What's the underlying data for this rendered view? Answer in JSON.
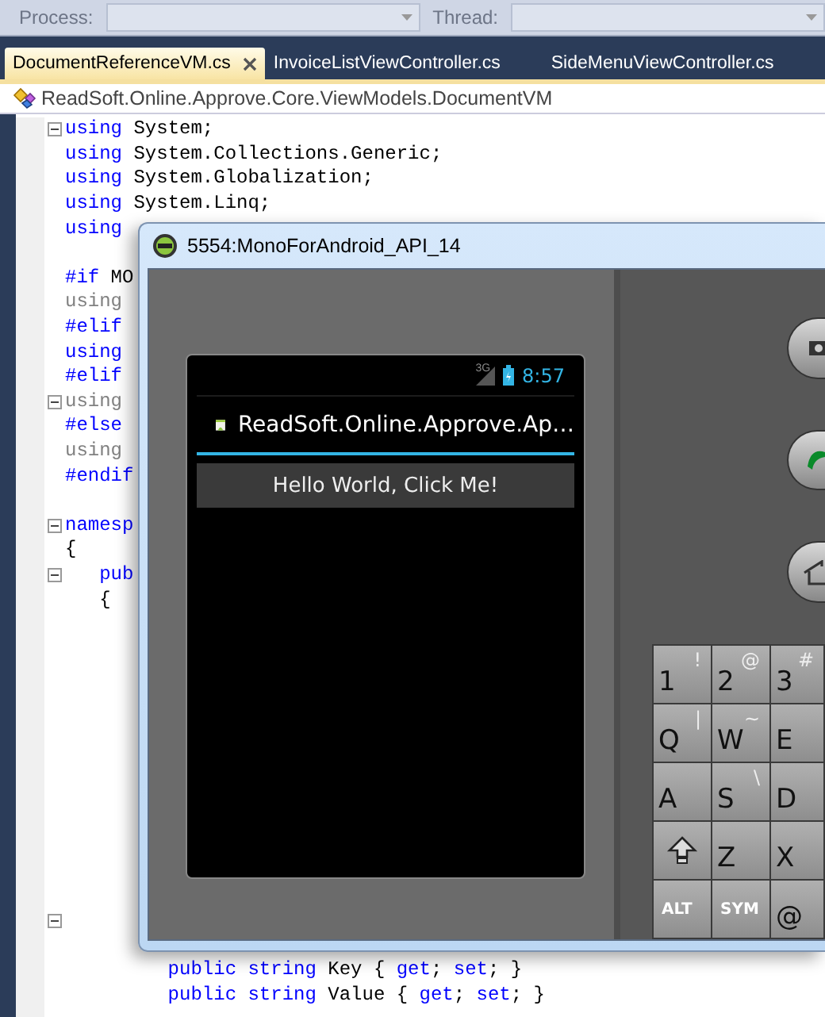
{
  "toolbar": {
    "fields": [
      {
        "label": "Process:"
      },
      {
        "label": "Thread:"
      }
    ]
  },
  "tabs": [
    {
      "label": "DocumentReferenceVM.cs",
      "selected": true,
      "closable": true
    },
    {
      "label": "InvoiceListViewController.cs",
      "selected": false,
      "closable": false
    },
    {
      "label": "SideMenuViewController.cs",
      "selected": false,
      "closable": false
    }
  ],
  "navigation_bar": {
    "type": "ReadSoft.Online.Approve.Core.ViewModels.DocumentVM"
  },
  "code_lines": [
    {
      "fold": true,
      "tokens": [
        {
          "text": "using",
          "kind": "keyword"
        },
        {
          "text": " System;",
          "kind": "plain"
        }
      ]
    },
    {
      "fold": false,
      "tokens": [
        {
          "text": "using",
          "kind": "keyword"
        },
        {
          "text": " System.Collections.Generic;",
          "kind": "plain"
        }
      ]
    },
    {
      "fold": false,
      "tokens": [
        {
          "text": "using",
          "kind": "keyword"
        },
        {
          "text": " System.Globalization;",
          "kind": "plain"
        }
      ]
    },
    {
      "fold": false,
      "tokens": [
        {
          "text": "using",
          "kind": "keyword"
        },
        {
          "text": " System.Linq;",
          "kind": "plain"
        }
      ]
    },
    {
      "fold": false,
      "tokens": [
        {
          "text": "using",
          "kind": "keyword"
        }
      ]
    },
    {
      "fold": false
    },
    {
      "fold": false,
      "tokens": [
        {
          "text": "#if",
          "kind": "keyword"
        },
        {
          "text": " MO",
          "kind": "plain"
        }
      ]
    },
    {
      "fold": false,
      "tokens": [
        {
          "text": "using",
          "kind": "inactive"
        }
      ]
    },
    {
      "fold": false,
      "tokens": [
        {
          "text": "#elif",
          "kind": "keyword"
        }
      ]
    },
    {
      "fold": false,
      "tokens": [
        {
          "text": "using",
          "kind": "keyword"
        }
      ]
    },
    {
      "fold": false,
      "tokens": [
        {
          "text": "#elif",
          "kind": "keyword"
        }
      ]
    },
    {
      "fold": true,
      "tokens": [
        {
          "text": "using",
          "kind": "inactive"
        }
      ]
    },
    {
      "fold": false,
      "tokens": [
        {
          "text": "#else",
          "kind": "keyword"
        }
      ]
    },
    {
      "fold": false,
      "tokens": [
        {
          "text": "using",
          "kind": "inactive"
        }
      ]
    },
    {
      "fold": false,
      "tokens": [
        {
          "text": "#endif",
          "kind": "keyword"
        }
      ]
    },
    {
      "fold": false
    },
    {
      "fold": true,
      "tokens": [
        {
          "text": "namesp",
          "kind": "keyword"
        }
      ]
    },
    {
      "fold": false,
      "tokens": [
        {
          "text": "{",
          "kind": "plain"
        }
      ]
    },
    {
      "fold": true,
      "tokens": [
        {
          "text": "   pub",
          "kind": "keyword"
        }
      ]
    },
    {
      "fold": false,
      "tokens": [
        {
          "text": "   {",
          "kind": "plain"
        }
      ]
    },
    {
      "fold": false
    },
    {
      "fold": false
    },
    {
      "fold": false
    },
    {
      "fold": false
    },
    {
      "fold": false
    },
    {
      "fold": false
    },
    {
      "fold": false
    },
    {
      "fold": false
    },
    {
      "fold": false
    },
    {
      "fold": false
    },
    {
      "fold": false
    },
    {
      "fold": false
    },
    {
      "fold": true
    },
    {
      "fold": false
    },
    {
      "fold": false,
      "tokens": [
        {
          "text": "         public string",
          "kind": "keyword"
        },
        {
          "text": " Key { ",
          "kind": "plain"
        },
        {
          "text": "get",
          "kind": "keyword"
        },
        {
          "text": "; ",
          "kind": "plain"
        },
        {
          "text": "set",
          "kind": "keyword"
        },
        {
          "text": "; }",
          "kind": "plain"
        }
      ]
    },
    {
      "fold": false,
      "tokens": [
        {
          "text": "         public string",
          "kind": "keyword"
        },
        {
          "text": " Value { ",
          "kind": "plain"
        },
        {
          "text": "get",
          "kind": "keyword"
        },
        {
          "text": "; ",
          "kind": "plain"
        },
        {
          "text": "set",
          "kind": "keyword"
        },
        {
          "text": "; }",
          "kind": "plain"
        }
      ]
    }
  ],
  "emulator": {
    "title": "5554:MonoForAndroid_API_14",
    "status_bar": {
      "network": "3G",
      "time": "8:57"
    },
    "app": {
      "title": "ReadSoft.Online.Approve.Ap…",
      "button": "Hello World, Click Me!"
    },
    "keyboard": {
      "rows": [
        [
          {
            "kind": "char",
            "main": "1",
            "alt": "!"
          },
          {
            "kind": "char",
            "main": "2",
            "alt": "@"
          },
          {
            "kind": "char",
            "main": "3",
            "alt": "#"
          }
        ],
        [
          {
            "kind": "char",
            "main": "Q",
            "alt": "|"
          },
          {
            "kind": "char",
            "main": "W",
            "alt": "~"
          },
          {
            "kind": "char",
            "main": "E"
          }
        ],
        [
          {
            "kind": "char",
            "main": "A"
          },
          {
            "kind": "char",
            "main": "S",
            "alt": "\\"
          },
          {
            "kind": "char",
            "main": "D"
          }
        ],
        [
          {
            "kind": "shift"
          },
          {
            "kind": "char",
            "main": "Z"
          },
          {
            "kind": "char",
            "main": "X"
          }
        ],
        [
          {
            "kind": "modifier",
            "main": "ALT"
          },
          {
            "kind": "modifier",
            "main": "SYM"
          },
          {
            "kind": "char",
            "main": "@"
          }
        ]
      ]
    }
  }
}
